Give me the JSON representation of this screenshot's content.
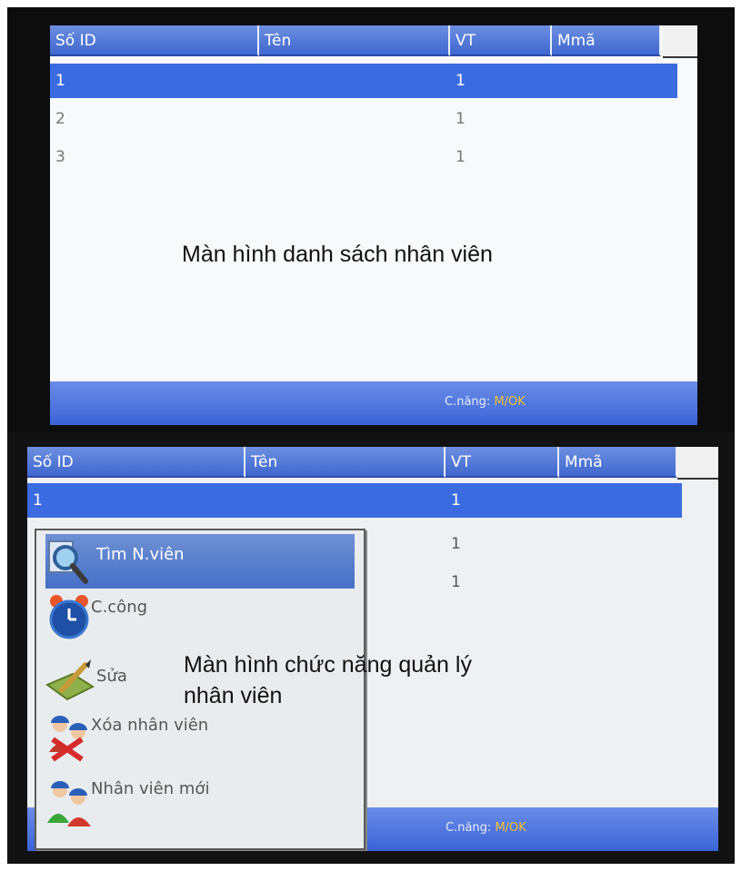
{
  "top_screen": {
    "columns": [
      "Số ID",
      "Tên",
      "VT",
      "Mmã"
    ],
    "rows": [
      {
        "id": "1",
        "ten": "",
        "vt": "1",
        "mma": "",
        "selected": true
      },
      {
        "id": "2",
        "ten": "",
        "vt": "1",
        "mma": "",
        "selected": false
      },
      {
        "id": "3",
        "ten": "",
        "vt": "1",
        "mma": "",
        "selected": false
      }
    ],
    "caption": "Màn hình danh sách nhân viên",
    "footer": {
      "label": "C.năng:",
      "key": "M/OK"
    }
  },
  "bottom_screen": {
    "columns": [
      "Số ID",
      "Tên",
      "VT",
      "Mmã"
    ],
    "rows": [
      {
        "id": "1",
        "vt": "1"
      },
      {
        "id": "",
        "vt": "1"
      },
      {
        "id": "",
        "vt": "1"
      }
    ],
    "menu": [
      {
        "label": "Tìm N.viên",
        "icon": "search-icon",
        "selected": true
      },
      {
        "label": "C.công",
        "icon": "alarm-clock-icon",
        "selected": false
      },
      {
        "label": "Sửa",
        "icon": "edit-notebook-icon",
        "selected": false
      },
      {
        "label": "Xóa nhân viên",
        "icon": "delete-users-icon",
        "selected": false
      },
      {
        "label": "Nhân viên mới",
        "icon": "new-users-icon",
        "selected": false
      }
    ],
    "caption_line1": "Màn hình chức năng quản lý",
    "caption_line2": "nhân viên",
    "footer": {
      "label": "C.năng:",
      "key": "M/OK"
    }
  },
  "colors": {
    "header_blue": "#3f67cf",
    "selection_blue": "#3b6be0",
    "footer_key": "#f1c232"
  }
}
